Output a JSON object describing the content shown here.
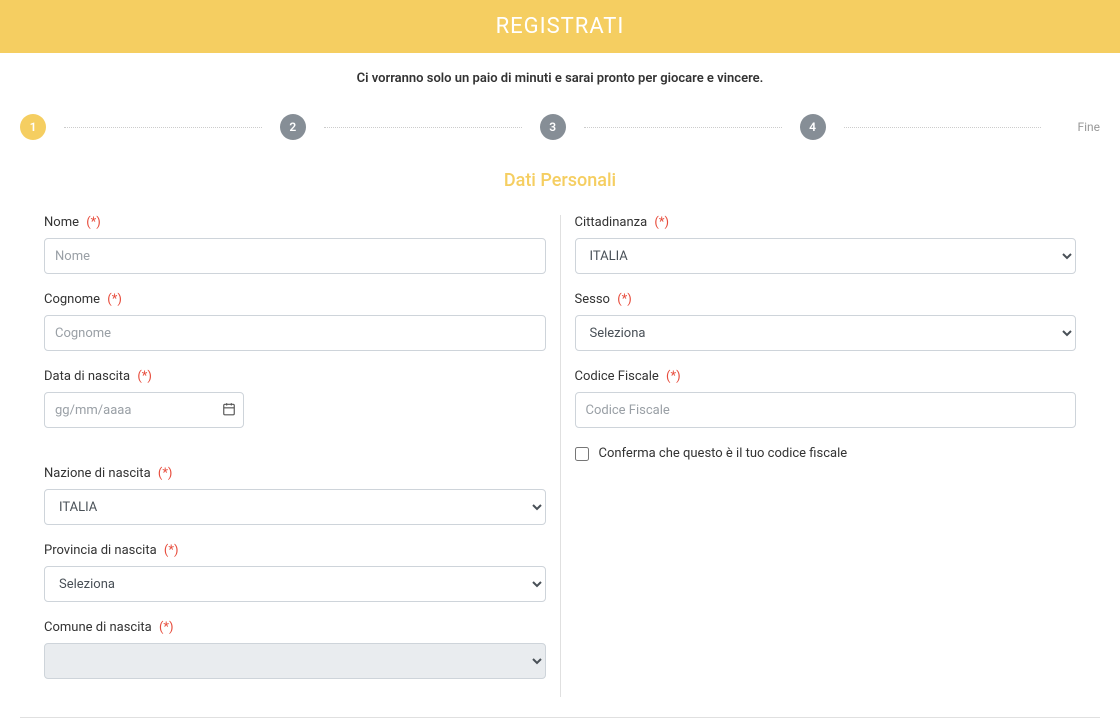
{
  "header": {
    "title": "REGISTRATI",
    "subtitle": "Ci vorranno solo un paio di minuti e sarai pronto per giocare e vincere."
  },
  "stepper": {
    "steps": [
      "1",
      "2",
      "3",
      "4"
    ],
    "active_index": 0,
    "end_label": "Fine"
  },
  "section_title": "Dati Personali",
  "required_mark": "(*)",
  "left_fields": {
    "nome": {
      "label": "Nome",
      "placeholder": "Nome"
    },
    "cognome": {
      "label": "Cognome",
      "placeholder": "Cognome"
    },
    "data_nascita": {
      "label": "Data di nascita",
      "placeholder": "gg/mm/aaaa"
    },
    "nazione_nascita": {
      "label": "Nazione di nascita",
      "selected": "ITALIA"
    },
    "provincia_nascita": {
      "label": "Provincia di nascita",
      "selected": "Seleziona"
    },
    "comune_nascita": {
      "label": "Comune di nascita",
      "selected": ""
    }
  },
  "right_fields": {
    "cittadinanza": {
      "label": "Cittadinanza",
      "selected": "ITALIA"
    },
    "sesso": {
      "label": "Sesso",
      "selected": "Seleziona"
    },
    "codice_fiscale": {
      "label": "Codice Fiscale",
      "placeholder": "Codice Fiscale"
    },
    "confirm_cf": {
      "label": "Conferma che questo è il tuo codice fiscale"
    }
  }
}
